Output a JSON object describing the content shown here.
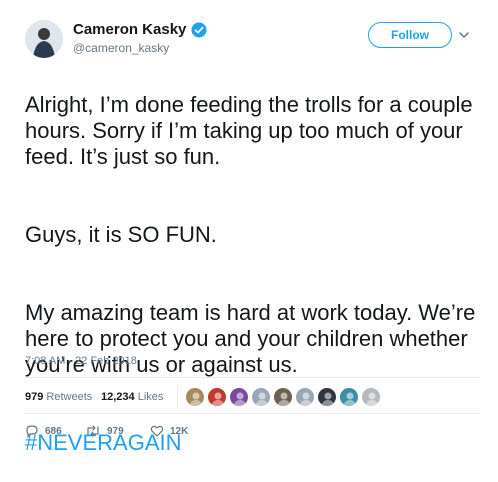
{
  "author": {
    "display_name": "Cameron Kasky",
    "handle": "@cameron_kasky",
    "verified": true
  },
  "follow_label": "Follow",
  "tweet": {
    "paragraphs": [
      "Alright, I’m done feeding the trolls for a couple hours. Sorry if I’m taking up too much of your feed. It’s just so fun.",
      "Guys, it is SO FUN.",
      "My amazing team is hard at work today. We’re here to protect you and your children whether you’re with us or against us."
    ],
    "hashtag": "#NEVERAGAIN",
    "timestamp": "7:08 AM - 22 Feb 2018"
  },
  "stats": {
    "retweets_count": "979",
    "retweets_label": "Retweets",
    "likes_count": "12,234",
    "likes_label": "Likes"
  },
  "liker_avatars": [
    "#a58a5a",
    "#c0392b",
    "#7b4aa0",
    "#9aa7b4",
    "#6b6150",
    "#9aa7b4",
    "#2f3640",
    "#3b8ea5",
    "#b4b9be"
  ],
  "actions": {
    "reply_count": "686",
    "retweet_count": "979",
    "like_count": "12K"
  },
  "colors": {
    "accent": "#1da1f2",
    "muted": "#657786",
    "text": "#14171a"
  }
}
